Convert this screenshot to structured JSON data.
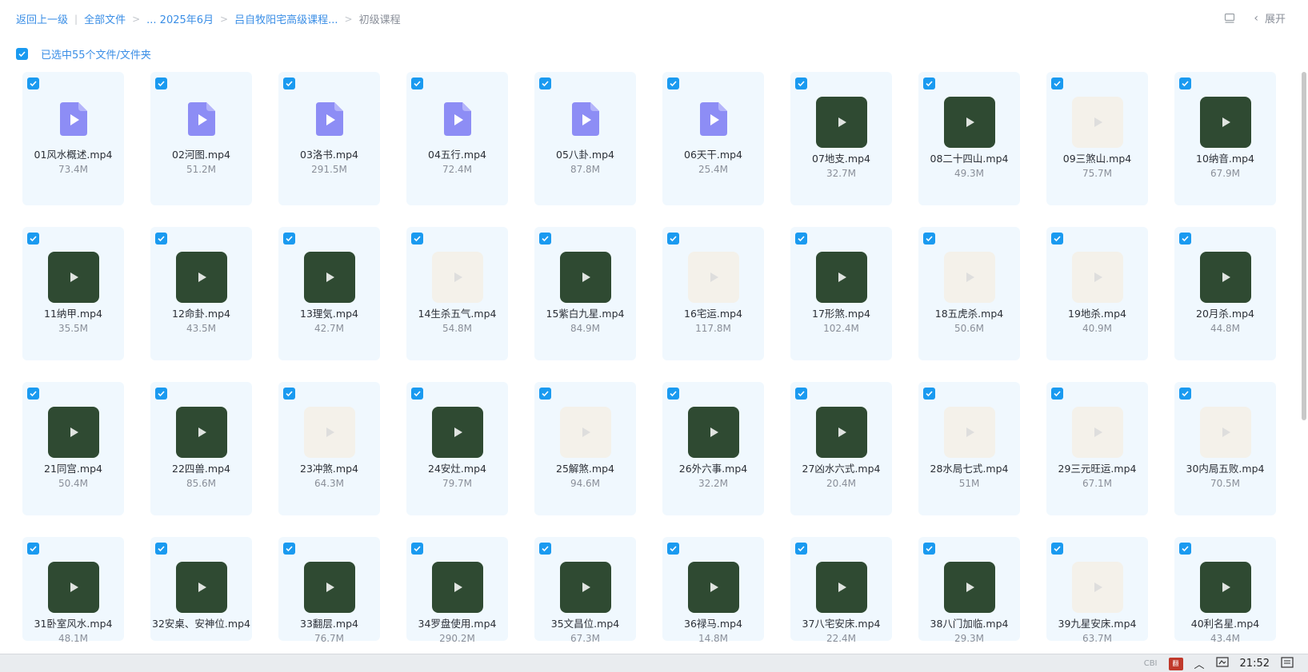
{
  "breadcrumbs": [
    {
      "label": "返回上一级",
      "current": false
    },
    {
      "label": "全部文件",
      "current": false
    },
    {
      "label": "... 2025年6月",
      "current": false
    },
    {
      "label": "吕自牧阳宅高级课程...",
      "current": false
    },
    {
      "label": "初级课程",
      "current": true
    }
  ],
  "toolbar": {
    "expand_label": "展开",
    "list_icon": "list-view-icon",
    "chevron_icon": "chevron-left-icon"
  },
  "selection": {
    "label": "已选中55个文件/文件夹",
    "checked": true
  },
  "files": [
    {
      "name": "01风水概述.mp4",
      "size": "73.4M",
      "thumb": "file"
    },
    {
      "name": "02河图.mp4",
      "size": "51.2M",
      "thumb": "file"
    },
    {
      "name": "03洛书.mp4",
      "size": "291.5M",
      "thumb": "file"
    },
    {
      "name": "04五行.mp4",
      "size": "72.4M",
      "thumb": "file"
    },
    {
      "name": "05八卦.mp4",
      "size": "87.8M",
      "thumb": "file"
    },
    {
      "name": "06天干.mp4",
      "size": "25.4M",
      "thumb": "file"
    },
    {
      "name": "07地支.mp4",
      "size": "32.7M",
      "thumb": "video"
    },
    {
      "name": "08二十四山.mp4",
      "size": "49.3M",
      "thumb": "video"
    },
    {
      "name": "09三煞山.mp4",
      "size": "75.7M",
      "thumb": "video-light"
    },
    {
      "name": "10纳音.mp4",
      "size": "67.9M",
      "thumb": "video"
    },
    {
      "name": "11纳甲.mp4",
      "size": "35.5M",
      "thumb": "video"
    },
    {
      "name": "12命卦.mp4",
      "size": "43.5M",
      "thumb": "video"
    },
    {
      "name": "13理気.mp4",
      "size": "42.7M",
      "thumb": "video"
    },
    {
      "name": "14生杀五气.mp4",
      "size": "54.8M",
      "thumb": "video-light"
    },
    {
      "name": "15紫白九星.mp4",
      "size": "84.9M",
      "thumb": "video"
    },
    {
      "name": "16宅运.mp4",
      "size": "117.8M",
      "thumb": "video-light"
    },
    {
      "name": "17形煞.mp4",
      "size": "102.4M",
      "thumb": "video"
    },
    {
      "name": "18五虎杀.mp4",
      "size": "50.6M",
      "thumb": "video-light"
    },
    {
      "name": "19地杀.mp4",
      "size": "40.9M",
      "thumb": "video-light"
    },
    {
      "name": "20月杀.mp4",
      "size": "44.8M",
      "thumb": "video"
    },
    {
      "name": "21同宫.mp4",
      "size": "50.4M",
      "thumb": "video"
    },
    {
      "name": "22四兽.mp4",
      "size": "85.6M",
      "thumb": "video"
    },
    {
      "name": "23冲煞.mp4",
      "size": "64.3M",
      "thumb": "video-light"
    },
    {
      "name": "24安灶.mp4",
      "size": "79.7M",
      "thumb": "video"
    },
    {
      "name": "25解煞.mp4",
      "size": "94.6M",
      "thumb": "video-light"
    },
    {
      "name": "26外六事.mp4",
      "size": "32.2M",
      "thumb": "video"
    },
    {
      "name": "27凶水六式.mp4",
      "size": "20.4M",
      "thumb": "video"
    },
    {
      "name": "28水局七式.mp4",
      "size": "51M",
      "thumb": "video-light"
    },
    {
      "name": "29三元旺运.mp4",
      "size": "67.1M",
      "thumb": "video-light"
    },
    {
      "name": "30内局五败.mp4",
      "size": "70.5M",
      "thumb": "video-light"
    },
    {
      "name": "31卧室风水.mp4",
      "size": "48.1M",
      "thumb": "video"
    },
    {
      "name": "32安桌、安神位.mp4",
      "size": "",
      "thumb": "video"
    },
    {
      "name": "33翻层.mp4",
      "size": "76.7M",
      "thumb": "video"
    },
    {
      "name": "34罗盘使用.mp4",
      "size": "290.2M",
      "thumb": "video"
    },
    {
      "name": "35文昌位.mp4",
      "size": "67.3M",
      "thumb": "video"
    },
    {
      "name": "36禄马.mp4",
      "size": "14.8M",
      "thumb": "video"
    },
    {
      "name": "37八宅安床.mp4",
      "size": "22.4M",
      "thumb": "video"
    },
    {
      "name": "38八门加临.mp4",
      "size": "29.3M",
      "thumb": "video"
    },
    {
      "name": "39九星安床.mp4",
      "size": "63.7M",
      "thumb": "video-light"
    },
    {
      "name": "40利名星.mp4",
      "size": "43.4M",
      "thumb": "video"
    }
  ],
  "taskbar": {
    "app_label": "CBI",
    "time": "21:52"
  }
}
